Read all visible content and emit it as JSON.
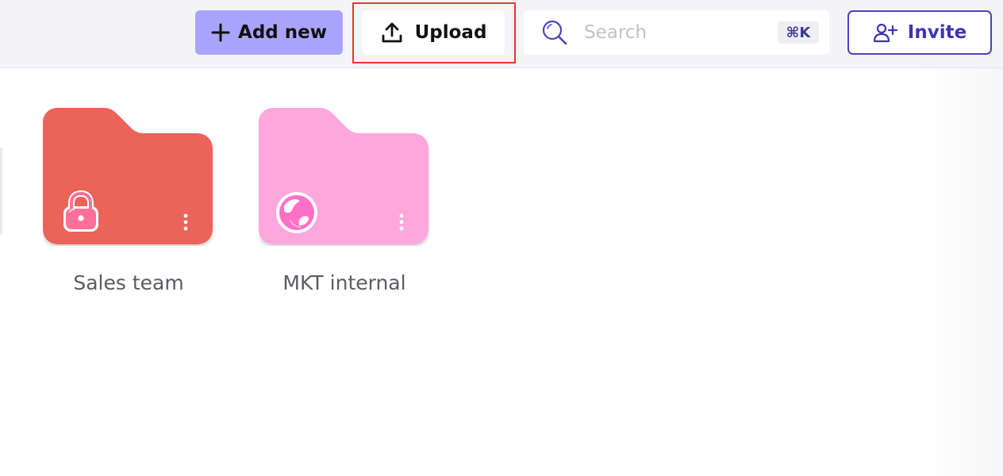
{
  "toolbar": {
    "add_new_label": "Add new",
    "upload_label": "Upload",
    "search_placeholder": "Search",
    "search_shortcut": "⌘K",
    "invite_label": "Invite"
  },
  "folders": [
    {
      "name": "Sales team",
      "color": "#ec635a",
      "badge": "lock-icon"
    },
    {
      "name": "MKT internal",
      "color": "#fea7dd",
      "badge": "globe-icon"
    }
  ],
  "colors": {
    "add_new_bg": "#a9a4fb",
    "invite_accent": "#4b43b8",
    "highlight": "#e53a2c",
    "search_icon": "#4b43b8"
  }
}
